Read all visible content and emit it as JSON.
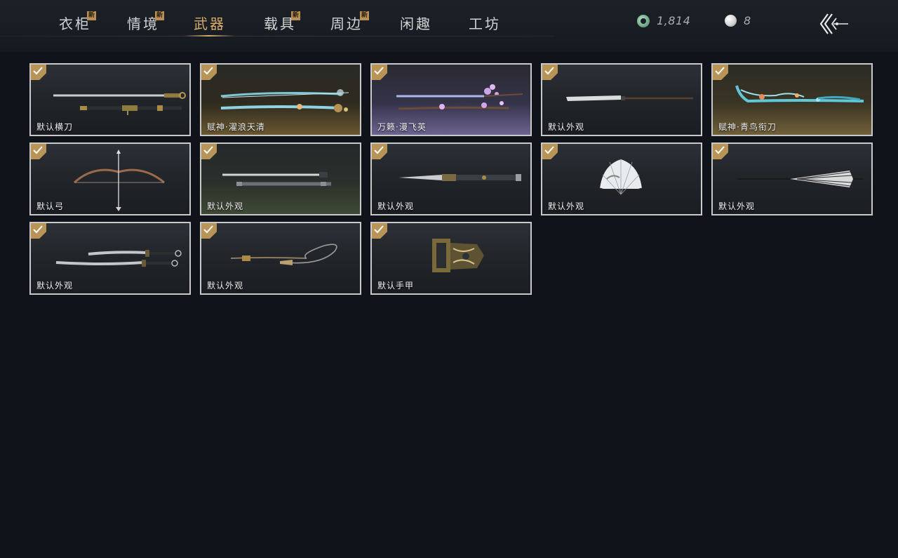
{
  "tabs": [
    {
      "label": "衣柜",
      "new": true,
      "badge": "新"
    },
    {
      "label": "情境",
      "new": true,
      "badge": "新"
    },
    {
      "label": "武器",
      "new": false,
      "active": true
    },
    {
      "label": "载具",
      "new": true,
      "badge": "新"
    },
    {
      "label": "周边",
      "new": true,
      "badge": "新"
    },
    {
      "label": "闲趣",
      "new": false
    },
    {
      "label": "工坊",
      "new": false
    }
  ],
  "currency": {
    "jade": {
      "icon": "jade-coin-icon",
      "value": "1,814"
    },
    "pearl": {
      "icon": "pearl-icon",
      "value": "8"
    }
  },
  "back_button": {
    "icon": "back-arrow-icon"
  },
  "accent_color": "#d6ad6c",
  "items": [
    {
      "label": "默认横刀",
      "art": "sword-icon",
      "owned": true
    },
    {
      "label": "赋神·濯浪天清",
      "art": "ornate-spear-icon",
      "owned": true
    },
    {
      "label": "万籁·漫飞英",
      "art": "blossom-sword-icon",
      "owned": true
    },
    {
      "label": "默认外观",
      "art": "long-blade-icon",
      "owned": true
    },
    {
      "label": "赋神·青鸟衔刀",
      "art": "phoenix-blade-icon",
      "owned": true
    },
    {
      "label": "默认弓",
      "art": "bow-icon",
      "owned": true
    },
    {
      "label": "默认外观",
      "art": "spear-icon",
      "owned": true
    },
    {
      "label": "默认外观",
      "art": "dagger-icon",
      "owned": true
    },
    {
      "label": "默认外观",
      "art": "fan-icon",
      "owned": true
    },
    {
      "label": "默认外观",
      "art": "umbrella-icon",
      "owned": true
    },
    {
      "label": "默认外观",
      "art": "dual-blades-icon",
      "owned": true
    },
    {
      "label": "默认外观",
      "art": "rope-dart-icon",
      "owned": true
    },
    {
      "label": "默认手甲",
      "art": "gauntlet-icon",
      "owned": true
    }
  ]
}
